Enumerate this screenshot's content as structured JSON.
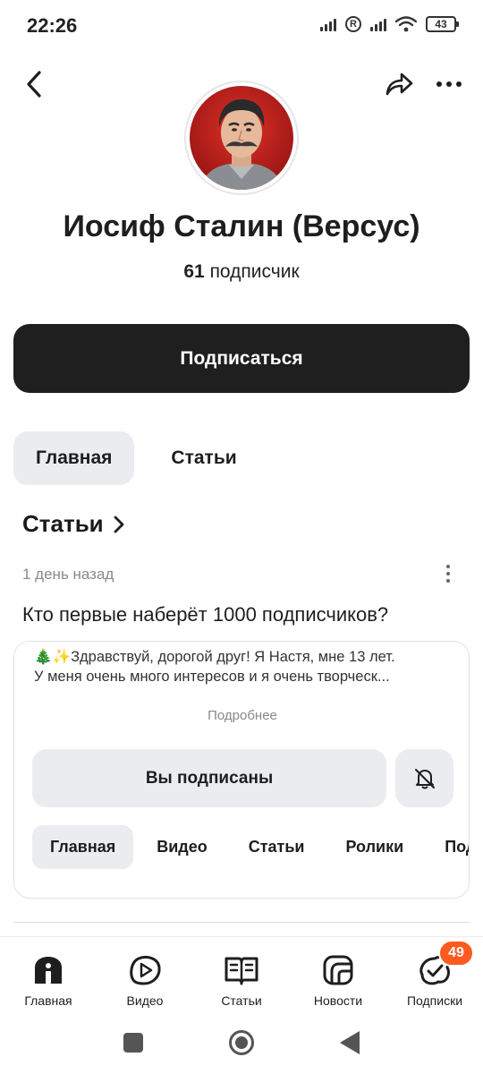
{
  "status_bar": {
    "time": "22:26",
    "battery": "43",
    "registered_mark": "R"
  },
  "header": {
    "back_icon": "chevron-left-icon",
    "share_icon": "share-arrow-icon",
    "more_icon": "more-dots-icon"
  },
  "channel": {
    "name": "Иосиф Сталин (Версус)",
    "subscriber_count": "61",
    "subscriber_label": "подписчик",
    "avatar_bg": "#c4201c"
  },
  "subscribe_button": {
    "label": "Подписаться",
    "color": "#1f1f1f"
  },
  "tabs": [
    {
      "label": "Главная",
      "active": true
    },
    {
      "label": "Статьи",
      "active": false
    }
  ],
  "section": {
    "title": "Статьи"
  },
  "post": {
    "time": "1 день назад",
    "title": "Кто первые наберёт 1000 подписчиков?",
    "card": {
      "description_line1": "🎄✨Здравствуй, дорогой друг! Я Настя, мне 13 лет.",
      "description_line2": "У меня очень много интересов и я очень творческ...",
      "more_label": "Подробнее",
      "subscribed_label": "Вы подписаны",
      "bell_icon": "bell-off-icon",
      "tabs": [
        "Главная",
        "Видео",
        "Статьи",
        "Ролики",
        "Под"
      ]
    }
  },
  "bottom_nav": [
    {
      "label": "Главная",
      "icon": "home-icon"
    },
    {
      "label": "Видео",
      "icon": "video-play-icon"
    },
    {
      "label": "Статьи",
      "icon": "book-icon"
    },
    {
      "label": "Новости",
      "icon": "news-icon"
    },
    {
      "label": "Подписки",
      "icon": "subscriptions-icon",
      "badge": "49"
    }
  ],
  "colors": {
    "badge": "#ff5a1f",
    "chip_bg": "#eaecf0"
  }
}
